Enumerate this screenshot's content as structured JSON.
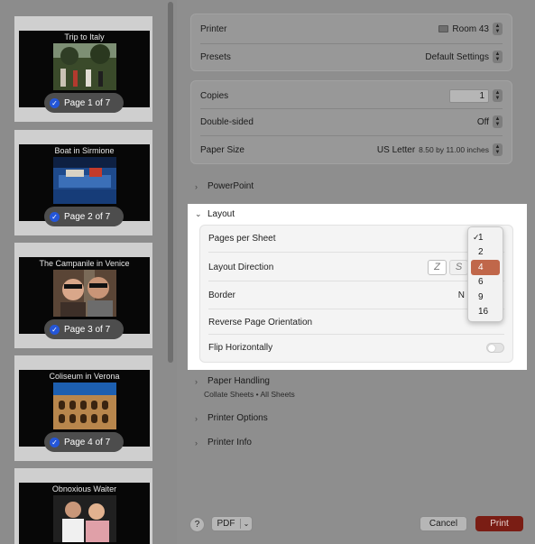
{
  "thumbnails": [
    {
      "title": "Trip to Italy",
      "page_label": "Page 1 of 7"
    },
    {
      "title": "Boat in Sirmione",
      "page_label": "Page 2 of 7"
    },
    {
      "title": "The Campanile in Venice",
      "page_label": "Page 3 of 7"
    },
    {
      "title": "Coliseum in Verona",
      "page_label": "Page 4 of 7"
    },
    {
      "title": "Obnoxious Waiter",
      "page_label": ""
    }
  ],
  "printer": {
    "label": "Printer",
    "value": "Room 43"
  },
  "presets": {
    "label": "Presets",
    "value": "Default Settings"
  },
  "copies": {
    "label": "Copies",
    "value": "1"
  },
  "double_sided": {
    "label": "Double-sided",
    "value": "Off"
  },
  "paper_size": {
    "label": "Paper Size",
    "value": "US Letter",
    "dimensions": "8.50 by 11.00 inches"
  },
  "sections": {
    "powerpoint": "PowerPoint",
    "layout": "Layout",
    "paper_handling": "Paper Handling",
    "paper_handling_sub": "Collate Sheets • All Sheets",
    "printer_options": "Printer Options",
    "printer_info": "Printer Info"
  },
  "layout": {
    "pages_per_sheet": "Pages per Sheet",
    "layout_direction": "Layout Direction",
    "border": "Border",
    "border_value": "N",
    "reverse_orientation": "Reverse Page Orientation",
    "flip_horizontally": "Flip Horizontally",
    "flip_horizontally_on": false
  },
  "menu": {
    "options": [
      "1",
      "2",
      "4",
      "6",
      "9",
      "16"
    ],
    "checked": "1",
    "highlighted": "4"
  },
  "footer": {
    "help": "?",
    "pdf": "PDF",
    "cancel": "Cancel",
    "print": "Print"
  },
  "colors": {
    "print_button": "#7a1d14",
    "menu_highlight": "#c0674a",
    "page_check": "#2456d8"
  }
}
